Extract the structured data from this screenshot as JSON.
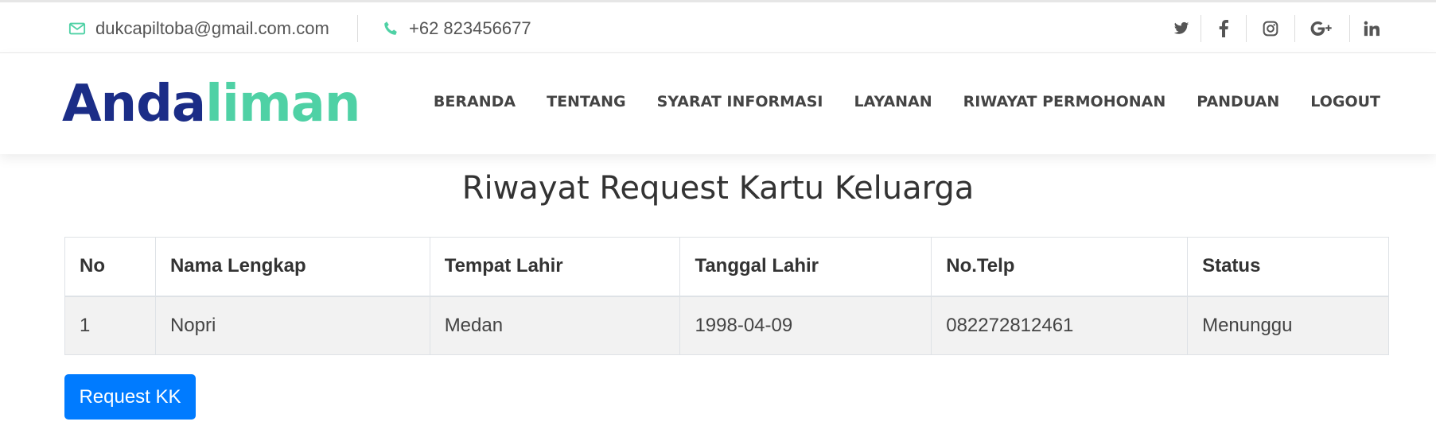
{
  "topbar": {
    "email": "dukcapiltoba@gmail.com.com",
    "phone": "+62 823456677",
    "social": [
      "twitter-icon",
      "facebook-icon",
      "instagram-icon",
      "google-plus-icon",
      "linkedin-icon"
    ]
  },
  "logo": {
    "part1": "Anda",
    "part2": "liman"
  },
  "colors": {
    "brand_dark": "#1b2d87",
    "brand_accent": "#4fd1a5",
    "button": "#007bff"
  },
  "nav": {
    "items": [
      "BERANDA",
      "TENTANG",
      "SYARAT INFORMASI",
      "LAYANAN",
      "RIWAYAT PERMOHONAN",
      "PANDUAN",
      "LOGOUT"
    ]
  },
  "page": {
    "title": "Riwayat Request Kartu Keluarga"
  },
  "table": {
    "headers": [
      "No",
      "Nama Lengkap",
      "Tempat Lahir",
      "Tanggal Lahir",
      "No.Telp",
      "Status"
    ],
    "rows": [
      [
        "1",
        "Nopri",
        "Medan",
        "1998-04-09",
        "082272812461",
        "Menunggu"
      ]
    ]
  },
  "actions": {
    "request_button": "Request KK"
  }
}
